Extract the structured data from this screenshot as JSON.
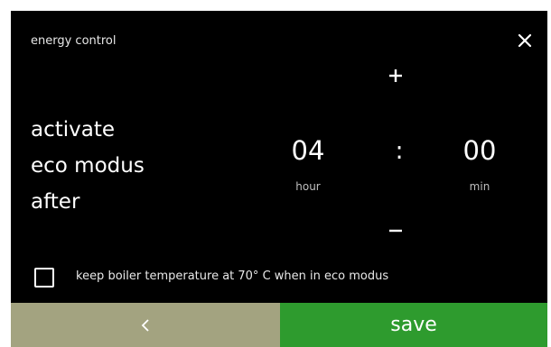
{
  "header": {
    "title": "energy control",
    "close_icon": "close-icon"
  },
  "description": {
    "lines": [
      "activate",
      "eco modus",
      "after"
    ]
  },
  "time": {
    "increment_icon": "plus-icon",
    "decrement_icon": "minus-icon",
    "hour_value": "04",
    "hour_unit": "hour",
    "separator": ":",
    "min_value": "00",
    "min_unit": "min"
  },
  "option": {
    "checked": false,
    "label": "keep boiler temperature at 70° C when in eco modus"
  },
  "footer": {
    "back_icon": "chevron-left-icon",
    "save_label": "save"
  },
  "colors": {
    "background": "#000000",
    "back_button": "#a3a380",
    "save_button": "#2e9b2e",
    "text": "#ffffff"
  }
}
